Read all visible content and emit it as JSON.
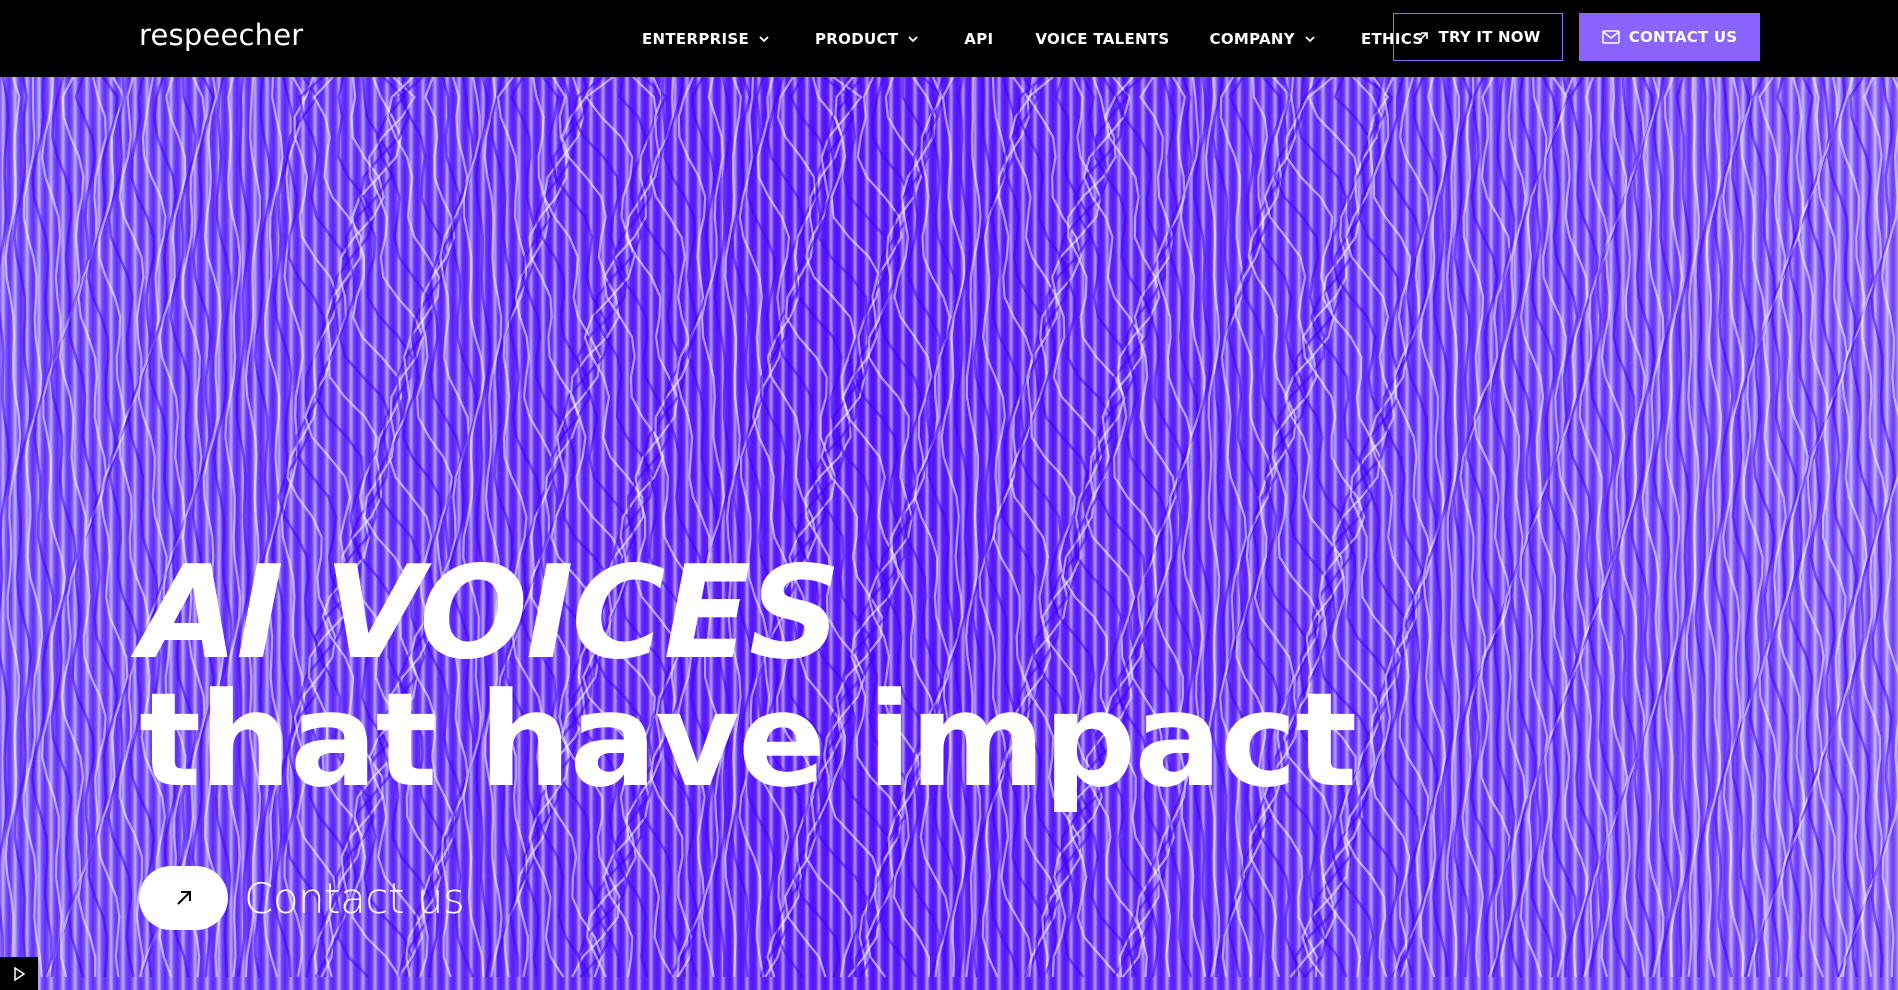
{
  "header": {
    "logo": "respeecher",
    "nav": [
      {
        "label": "ENTERPRISE",
        "dropdown": true
      },
      {
        "label": "PRODUCT",
        "dropdown": true
      },
      {
        "label": "API",
        "dropdown": false
      },
      {
        "label": "VOICE TALENTS",
        "dropdown": false
      },
      {
        "label": "COMPANY",
        "dropdown": true
      },
      {
        "label": "ETHICS",
        "dropdown": false
      }
    ],
    "try_button": "TRY IT NOW",
    "contact_button": "CONTACT US"
  },
  "hero": {
    "headline_line1": "AI VOICES",
    "headline_line2": "that have impact",
    "cta_label": "Contact us"
  },
  "colors": {
    "brand": "#8b63ff",
    "hero_purple": "#5a1cff",
    "header_bg": "#000000"
  },
  "icons": {
    "chevron": "chevron-down-icon",
    "arrow": "arrow-up-right-icon",
    "mail": "mail-icon",
    "play": "play-icon"
  }
}
